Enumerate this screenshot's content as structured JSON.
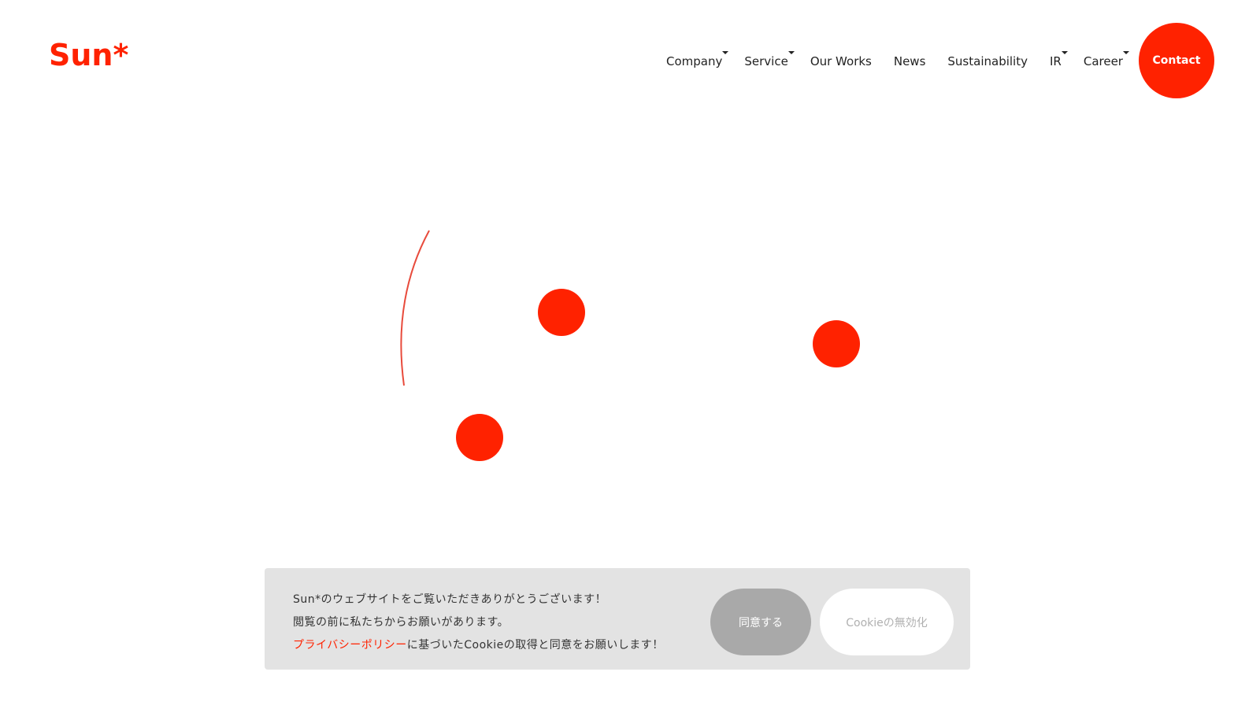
{
  "header": {
    "logo_text": "Sun*",
    "nav": [
      {
        "label": "Company",
        "has_dropdown": true
      },
      {
        "label": "Service",
        "has_dropdown": true
      },
      {
        "label": "Our Works",
        "has_dropdown": false
      },
      {
        "label": "News",
        "has_dropdown": false
      },
      {
        "label": "Sustainability",
        "has_dropdown": false
      },
      {
        "label": "IR",
        "has_dropdown": true
      },
      {
        "label": "Career",
        "has_dropdown": true
      }
    ],
    "contact_label": "Contact"
  },
  "hero": {
    "dot_color": "#ff2200",
    "arc_color": "#e84b3c"
  },
  "cookie_banner": {
    "line1": "Sun*のウェブサイトをご覧いただきありがとうございます！",
    "line2": "閲覧の前に私たちからお願いがあります。",
    "policy_link": "プライバシーポリシー",
    "line3_rest": "に基づいたCookieの取得と同意をお願いします！",
    "agree_label": "同意する",
    "disable_label": "Cookieの無効化"
  },
  "colors": {
    "brand": "#ff2200",
    "banner_bg": "#e3e3e3",
    "agree_bg": "#a9a9a9"
  }
}
